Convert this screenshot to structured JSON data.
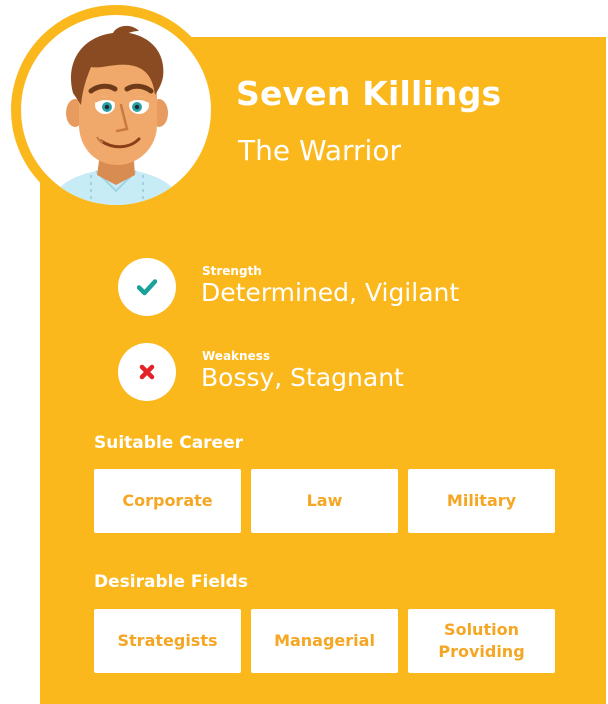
{
  "profile": {
    "name": "Seven Killings",
    "subtitle": "The Warrior",
    "avatar_icon": "man-avatar-icon"
  },
  "traits": {
    "strength": {
      "label": "Strength",
      "value": "Determined, Vigilant",
      "icon": "check-icon",
      "icon_color": "#1aa19a"
    },
    "weakness": {
      "label": "Weakness",
      "value": "Bossy, Stagnant",
      "icon": "cross-icon",
      "icon_color": "#e3222a"
    }
  },
  "careers": {
    "title": "Suitable Career",
    "items": [
      "Corporate",
      "Law",
      "Military"
    ]
  },
  "fields": {
    "title": "Desirable Fields",
    "items": [
      "Strategists",
      "Managerial",
      "Solution Providing"
    ]
  },
  "colors": {
    "card_background": "#fbb81d",
    "chip_text": "#f5a623",
    "text": "#ffffff"
  }
}
